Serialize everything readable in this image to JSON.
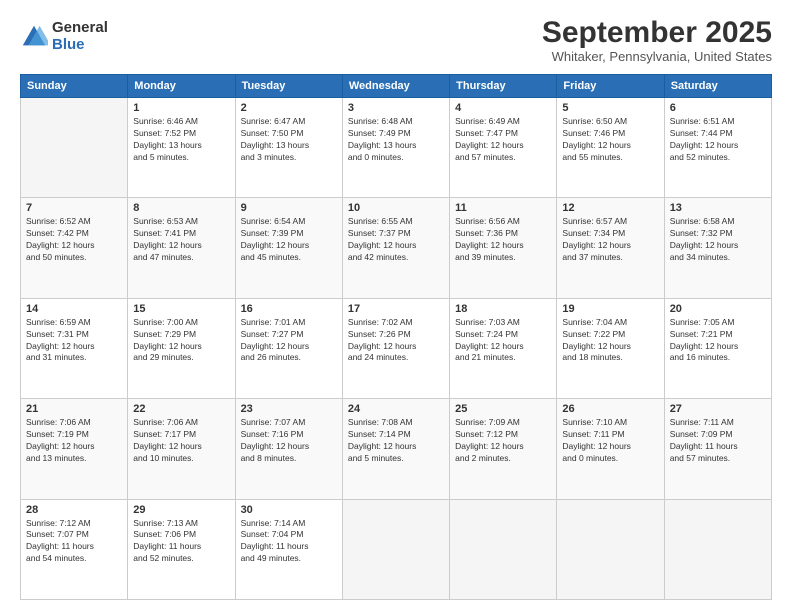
{
  "header": {
    "logo": {
      "general": "General",
      "blue": "Blue"
    },
    "title": "September 2025",
    "location": "Whitaker, Pennsylvania, United States"
  },
  "calendar": {
    "days_of_week": [
      "Sunday",
      "Monday",
      "Tuesday",
      "Wednesday",
      "Thursday",
      "Friday",
      "Saturday"
    ],
    "weeks": [
      [
        {
          "day": "",
          "info": ""
        },
        {
          "day": "1",
          "info": "Sunrise: 6:46 AM\nSunset: 7:52 PM\nDaylight: 13 hours\nand 5 minutes."
        },
        {
          "day": "2",
          "info": "Sunrise: 6:47 AM\nSunset: 7:50 PM\nDaylight: 13 hours\nand 3 minutes."
        },
        {
          "day": "3",
          "info": "Sunrise: 6:48 AM\nSunset: 7:49 PM\nDaylight: 13 hours\nand 0 minutes."
        },
        {
          "day": "4",
          "info": "Sunrise: 6:49 AM\nSunset: 7:47 PM\nDaylight: 12 hours\nand 57 minutes."
        },
        {
          "day": "5",
          "info": "Sunrise: 6:50 AM\nSunset: 7:46 PM\nDaylight: 12 hours\nand 55 minutes."
        },
        {
          "day": "6",
          "info": "Sunrise: 6:51 AM\nSunset: 7:44 PM\nDaylight: 12 hours\nand 52 minutes."
        }
      ],
      [
        {
          "day": "7",
          "info": "Sunrise: 6:52 AM\nSunset: 7:42 PM\nDaylight: 12 hours\nand 50 minutes."
        },
        {
          "day": "8",
          "info": "Sunrise: 6:53 AM\nSunset: 7:41 PM\nDaylight: 12 hours\nand 47 minutes."
        },
        {
          "day": "9",
          "info": "Sunrise: 6:54 AM\nSunset: 7:39 PM\nDaylight: 12 hours\nand 45 minutes."
        },
        {
          "day": "10",
          "info": "Sunrise: 6:55 AM\nSunset: 7:37 PM\nDaylight: 12 hours\nand 42 minutes."
        },
        {
          "day": "11",
          "info": "Sunrise: 6:56 AM\nSunset: 7:36 PM\nDaylight: 12 hours\nand 39 minutes."
        },
        {
          "day": "12",
          "info": "Sunrise: 6:57 AM\nSunset: 7:34 PM\nDaylight: 12 hours\nand 37 minutes."
        },
        {
          "day": "13",
          "info": "Sunrise: 6:58 AM\nSunset: 7:32 PM\nDaylight: 12 hours\nand 34 minutes."
        }
      ],
      [
        {
          "day": "14",
          "info": "Sunrise: 6:59 AM\nSunset: 7:31 PM\nDaylight: 12 hours\nand 31 minutes."
        },
        {
          "day": "15",
          "info": "Sunrise: 7:00 AM\nSunset: 7:29 PM\nDaylight: 12 hours\nand 29 minutes."
        },
        {
          "day": "16",
          "info": "Sunrise: 7:01 AM\nSunset: 7:27 PM\nDaylight: 12 hours\nand 26 minutes."
        },
        {
          "day": "17",
          "info": "Sunrise: 7:02 AM\nSunset: 7:26 PM\nDaylight: 12 hours\nand 24 minutes."
        },
        {
          "day": "18",
          "info": "Sunrise: 7:03 AM\nSunset: 7:24 PM\nDaylight: 12 hours\nand 21 minutes."
        },
        {
          "day": "19",
          "info": "Sunrise: 7:04 AM\nSunset: 7:22 PM\nDaylight: 12 hours\nand 18 minutes."
        },
        {
          "day": "20",
          "info": "Sunrise: 7:05 AM\nSunset: 7:21 PM\nDaylight: 12 hours\nand 16 minutes."
        }
      ],
      [
        {
          "day": "21",
          "info": "Sunrise: 7:06 AM\nSunset: 7:19 PM\nDaylight: 12 hours\nand 13 minutes."
        },
        {
          "day": "22",
          "info": "Sunrise: 7:06 AM\nSunset: 7:17 PM\nDaylight: 12 hours\nand 10 minutes."
        },
        {
          "day": "23",
          "info": "Sunrise: 7:07 AM\nSunset: 7:16 PM\nDaylight: 12 hours\nand 8 minutes."
        },
        {
          "day": "24",
          "info": "Sunrise: 7:08 AM\nSunset: 7:14 PM\nDaylight: 12 hours\nand 5 minutes."
        },
        {
          "day": "25",
          "info": "Sunrise: 7:09 AM\nSunset: 7:12 PM\nDaylight: 12 hours\nand 2 minutes."
        },
        {
          "day": "26",
          "info": "Sunrise: 7:10 AM\nSunset: 7:11 PM\nDaylight: 12 hours\nand 0 minutes."
        },
        {
          "day": "27",
          "info": "Sunrise: 7:11 AM\nSunset: 7:09 PM\nDaylight: 11 hours\nand 57 minutes."
        }
      ],
      [
        {
          "day": "28",
          "info": "Sunrise: 7:12 AM\nSunset: 7:07 PM\nDaylight: 11 hours\nand 54 minutes."
        },
        {
          "day": "29",
          "info": "Sunrise: 7:13 AM\nSunset: 7:06 PM\nDaylight: 11 hours\nand 52 minutes."
        },
        {
          "day": "30",
          "info": "Sunrise: 7:14 AM\nSunset: 7:04 PM\nDaylight: 11 hours\nand 49 minutes."
        },
        {
          "day": "",
          "info": ""
        },
        {
          "day": "",
          "info": ""
        },
        {
          "day": "",
          "info": ""
        },
        {
          "day": "",
          "info": ""
        }
      ]
    ]
  }
}
